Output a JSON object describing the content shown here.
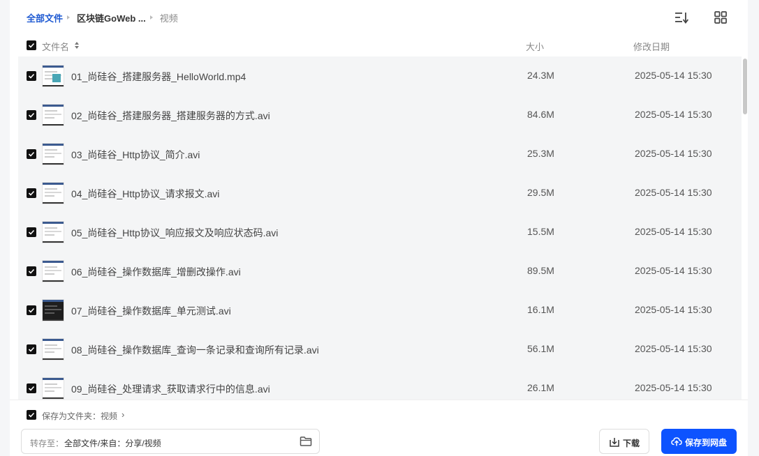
{
  "breadcrumb": {
    "root": "全部文件",
    "mid": "区块链GoWeb ...",
    "current": "视频"
  },
  "columns": {
    "name": "文件名",
    "size": "大小",
    "date": "修改日期"
  },
  "files": [
    {
      "name": "01_尚硅谷_搭建服务器_HelloWorld.mp4",
      "size": "24.3M",
      "date": "2025-05-14 15:30",
      "thumb": "light-blob"
    },
    {
      "name": "02_尚硅谷_搭建服务器_搭建服务器的方式.avi",
      "size": "84.6M",
      "date": "2025-05-14 15:30",
      "thumb": "light"
    },
    {
      "name": "03_尚硅谷_Http协议_简介.avi",
      "size": "25.3M",
      "date": "2025-05-14 15:30",
      "thumb": "light"
    },
    {
      "name": "04_尚硅谷_Http协议_请求报文.avi",
      "size": "29.5M",
      "date": "2025-05-14 15:30",
      "thumb": "light"
    },
    {
      "name": "05_尚硅谷_Http协议_响应报文及响应状态码.avi",
      "size": "15.5M",
      "date": "2025-05-14 15:30",
      "thumb": "light"
    },
    {
      "name": "06_尚硅谷_操作数据库_增删改操作.avi",
      "size": "89.5M",
      "date": "2025-05-14 15:30",
      "thumb": "light"
    },
    {
      "name": "07_尚硅谷_操作数据库_单元测试.avi",
      "size": "16.1M",
      "date": "2025-05-14 15:30",
      "thumb": "dark"
    },
    {
      "name": "08_尚硅谷_操作数据库_查询一条记录和查询所有记录.avi",
      "size": "56.1M",
      "date": "2025-05-14 15:30",
      "thumb": "light"
    },
    {
      "name": "09_尚硅谷_处理请求_获取请求行中的信息.avi",
      "size": "26.1M",
      "date": "2025-05-14 15:30",
      "thumb": "light"
    }
  ],
  "footer": {
    "save_folder_label": "保存为文件夹：视频",
    "path_label": "转存至：",
    "path_value": "全部文件/来自：分享/视频",
    "download_label": "下载",
    "save_label": "保存到网盘"
  },
  "colors": {
    "primary": "#0d53ff",
    "row_bg": "#f4f5f6"
  },
  "icons": [
    "sort-icon",
    "grid-view-icon",
    "folder-icon",
    "download-icon",
    "cloud-upload-icon",
    "checkbox-icon"
  ]
}
